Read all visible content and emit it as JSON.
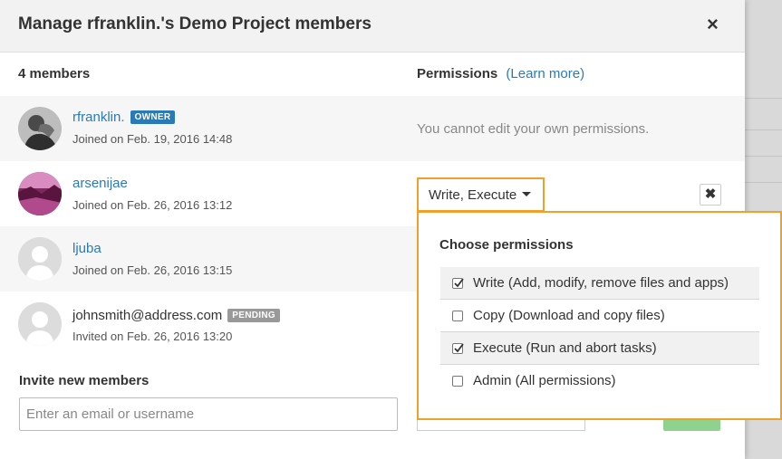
{
  "dialog": {
    "title": "Manage rfranklin.'s Demo Project members",
    "close_glyph": "×"
  },
  "columns": {
    "members_count": "4 members",
    "permissions": "Permissions",
    "learn_more": "(Learn more)"
  },
  "members": [
    {
      "name": "rfranklin.",
      "badge": "OWNER",
      "date": "Joined on Feb. 19, 2016 14:48",
      "permissions_text": "You cannot edit your own permissions."
    },
    {
      "name": "arsenijae",
      "date": "Joined on Feb. 26, 2016 13:12",
      "permissions_value": "Write, Execute",
      "remove_glyph": "✖"
    },
    {
      "name": "ljuba",
      "date": "Joined on Feb. 26, 2016 13:15"
    },
    {
      "name": "johnsmith@address.com",
      "badge": "PENDING",
      "date": "Invited on Feb. 26, 2016 13:20"
    }
  ],
  "invite": {
    "title": "Invite new members",
    "placeholder": "Enter an email or username"
  },
  "permissions_popover": {
    "title": "Choose permissions",
    "options": [
      {
        "label": "Write (Add, modify, remove files and apps)",
        "checked": true
      },
      {
        "label": "Copy (Download and copy files)",
        "checked": false
      },
      {
        "label": "Execute (Run and abort tasks)",
        "checked": true
      },
      {
        "label": "Admin (All permissions)",
        "checked": false
      }
    ]
  },
  "colors": {
    "link": "#2a7ab8",
    "highlight": "#f0a12b",
    "owner_badge": "#2a7ab8",
    "pending_badge": "#999999"
  },
  "icons": {
    "close": "close-icon",
    "caret": "caret-down-icon",
    "remove": "remove-member-icon",
    "checkbox_checked": "checkmark-icon"
  }
}
